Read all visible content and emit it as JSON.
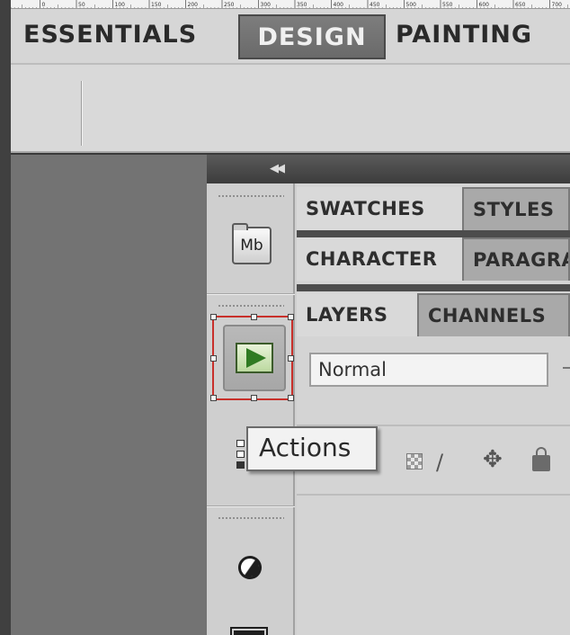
{
  "ruler": {
    "ticks": [
      "0",
      "0",
      "50",
      "100",
      "150",
      "200",
      "250",
      "300",
      "350",
      "400",
      "450",
      "500",
      "550",
      "600",
      "650",
      "700"
    ]
  },
  "workspace": {
    "tabs": [
      "ESSENTIALS",
      "DESIGN",
      "PAINTING"
    ],
    "active": "DESIGN"
  },
  "dock": {
    "collapse_glyph": "◀◀",
    "icons": [
      "mini-bridge-icon",
      "actions-play-icon",
      "history-icon",
      "adjustments-icon",
      "masks-icon"
    ],
    "mini_bridge_label": "Mb",
    "tooltip": "Actions"
  },
  "panels": {
    "group1": {
      "tabs": [
        "SWATCHES",
        "STYLES"
      ]
    },
    "group2": {
      "tabs": [
        "CHARACTER",
        "PARAGRAPH"
      ]
    },
    "group3": {
      "tabs": [
        "LAYERS",
        "CHANNELS"
      ]
    },
    "blend_mode": "Normal",
    "lock_icons": [
      "transparency-lock-icon",
      "brush-lock-icon",
      "move-lock-icon",
      "lock-icon"
    ]
  },
  "colors": {
    "selection": "#c8302b",
    "play": "#2f7a22",
    "active_workspace": "#6a6a6a"
  }
}
